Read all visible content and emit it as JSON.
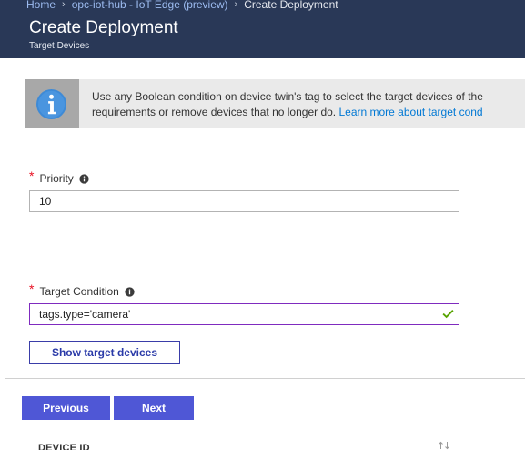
{
  "breadcrumb": {
    "items": [
      {
        "label": "Home"
      },
      {
        "label": "opc-iot-hub - IoT Edge (preview)"
      }
    ],
    "current": "Create Deployment"
  },
  "header": {
    "title": "Create Deployment",
    "subtitle": "Target Devices"
  },
  "info_banner": {
    "icon": "info-icon",
    "line1": "Use any Boolean condition on device twin's tag to select the target devices of the",
    "line2": "requirements or remove devices that no longer do. ",
    "link": "Learn more about target cond"
  },
  "priority": {
    "label": "Priority",
    "required_marker": "*",
    "value": "10"
  },
  "target_condition": {
    "label": "Target Condition",
    "required_marker": "*",
    "value": "tags.type='camera'",
    "valid_icon": "checkmark-icon"
  },
  "buttons": {
    "show_targets": "Show target devices",
    "previous": "Previous",
    "next": "Next"
  },
  "table": {
    "columns": [
      "DEVICE ID"
    ],
    "sort_icon": "sort-arrows-icon"
  },
  "colors": {
    "header_bg": "#293857",
    "primary_button": "#4f57d6",
    "link": "#0078d4",
    "valid_border": "#7f2bbf",
    "valid_check": "#57a300",
    "required": "#e81123"
  }
}
